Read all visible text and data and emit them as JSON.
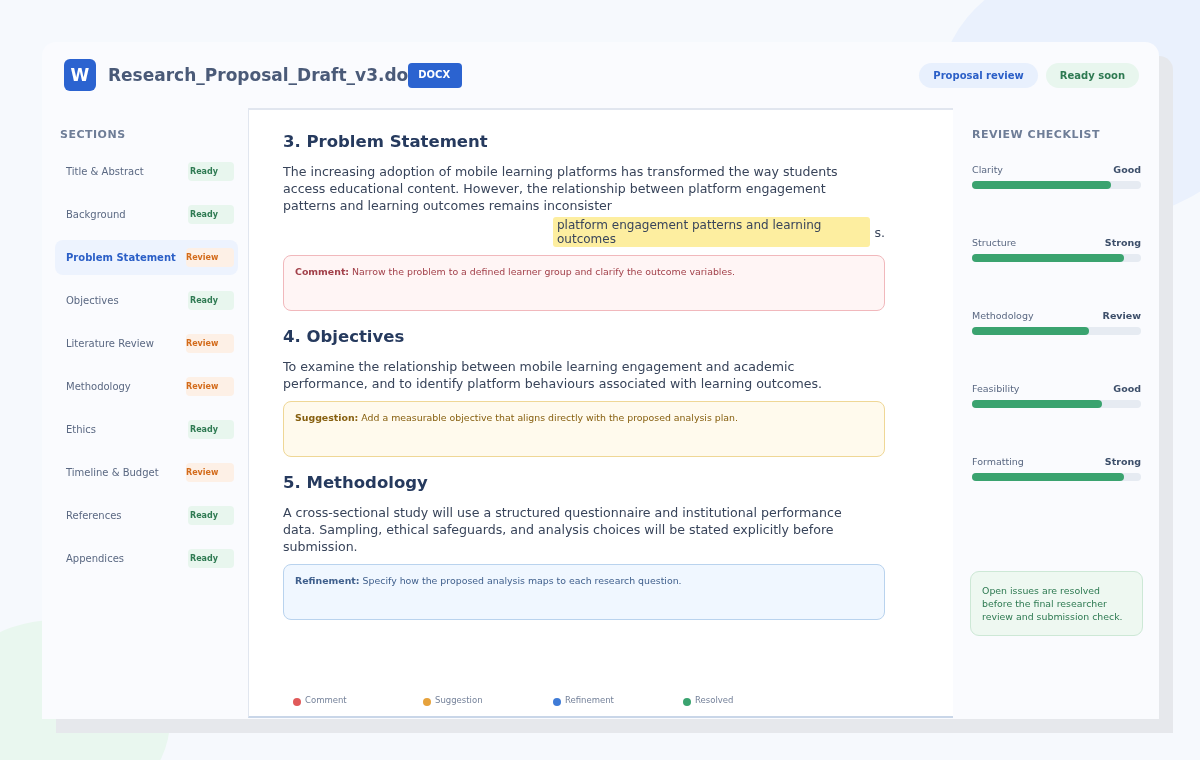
{
  "file": {
    "icon_letter": "W",
    "name": "Research_Proposal_Draft_v3.do",
    "format": "DOCX"
  },
  "header_pills": [
    {
      "kind": "info",
      "label": "Proposal review"
    },
    {
      "kind": "success",
      "label": "Ready soon"
    }
  ],
  "sidebar": {
    "title": "SECTIONS",
    "items": [
      {
        "label": "Title & Abstract",
        "status": "Ready",
        "kind": "ready",
        "selected": false
      },
      {
        "label": "Background",
        "status": "Ready",
        "kind": "ready",
        "selected": false
      },
      {
        "label": "Problem Statement",
        "status": "Review",
        "kind": "review",
        "selected": true
      },
      {
        "label": "Objectives",
        "status": "Ready",
        "kind": "ready",
        "selected": false
      },
      {
        "label": "Literature Review",
        "status": "Review",
        "kind": "review",
        "selected": false
      },
      {
        "label": "Methodology",
        "status": "Review",
        "kind": "review",
        "selected": false
      },
      {
        "label": "Ethics",
        "status": "Ready",
        "kind": "ready",
        "selected": false
      },
      {
        "label": "Timeline & Budget",
        "status": "Review",
        "kind": "review",
        "selected": false
      },
      {
        "label": "References",
        "status": "Ready",
        "kind": "ready",
        "selected": false
      },
      {
        "label": "Appendices",
        "status": "Ready",
        "kind": "ready",
        "selected": false
      }
    ]
  },
  "document": {
    "sections": [
      {
        "heading": "3. Problem Statement",
        "body": "The increasing adoption of mobile learning platforms has transformed the way students access educational content. However, the relationship between platform engagement patterns and learning outcomes remains inconsister",
        "highlight": "platform engagement patterns and learning outcomes",
        "body_tail": "s.",
        "note": {
          "kind": "comment",
          "text": "**Comment:** Narrow the problem to a defined learner group and clarify the outcome variables."
        }
      },
      {
        "heading": "4. Objectives",
        "body": "To examine the relationship between mobile learning engagement and academic performance, and to identify platform behaviours associated with learning outcomes.",
        "note": {
          "kind": "suggestion",
          "text": "**Suggestion:** Add a measurable objective that aligns directly with the proposed analysis plan."
        }
      },
      {
        "heading": "5. Methodology",
        "body": "A cross-sectional study will use a structured questionnaire and institutional performance data. Sampling, ethical safeguards, and analysis choices will be stated explicitly before submission.",
        "note": {
          "kind": "refinement",
          "text": "**Refinement:** Specify how the proposed analysis maps to each research question."
        }
      }
    ],
    "legend": [
      {
        "label": "Comment",
        "color": "#e05a5a"
      },
      {
        "label": "Suggestion",
        "color": "#e6a23c"
      },
      {
        "label": "Refinement",
        "color": "#3f7bd6"
      },
      {
        "label": "Resolved",
        "color": "#3aa36f"
      }
    ]
  },
  "checklist": {
    "title": "REVIEW CHECKLIST",
    "items": [
      {
        "label": "Clarity",
        "rating": "Good",
        "level": 0.82
      },
      {
        "label": "Structure",
        "rating": "Strong",
        "level": 0.9
      },
      {
        "label": "Methodology",
        "rating": "Review",
        "level": 0.69
      },
      {
        "label": "Feasibility",
        "rating": "Good",
        "level": 0.77
      },
      {
        "label": "Formatting",
        "rating": "Strong",
        "level": 0.9
      }
    ],
    "note": "Open issues are resolved before the final researcher review and submission check."
  }
}
